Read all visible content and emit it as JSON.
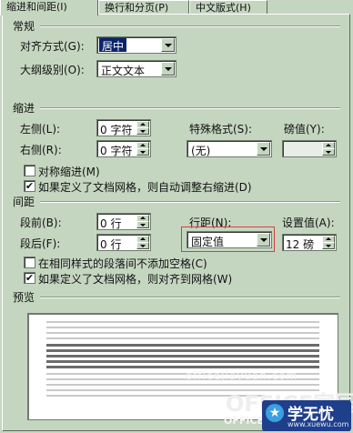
{
  "tabs": [
    {
      "label": "缩进和间距(I)"
    },
    {
      "label": "换行和分页(P)"
    },
    {
      "label": "中文版式(H)"
    }
  ],
  "general": {
    "title": "常规",
    "alignment_label": "对齐方式(G):",
    "alignment_value": "居中",
    "outline_label": "大纲级别(O):",
    "outline_value": "正文文本"
  },
  "indent": {
    "title": "缩进",
    "left_label": "左侧(L):",
    "left_value": "0 字符",
    "right_label": "右侧(R):",
    "right_value": "0 字符",
    "special_label": "特殊格式(S):",
    "special_value": "(无)",
    "by_label": "磅值(Y):",
    "by_value": "",
    "mirror_label": "对称缩进(M)",
    "mirror_checked": false,
    "auto_adjust_label": "如果定义了文档网格，则自动调整右缩进(D)",
    "auto_adjust_checked": true
  },
  "spacing": {
    "title": "间距",
    "before_label": "段前(B):",
    "before_value": "0 行",
    "after_label": "段后(F):",
    "after_value": "0 行",
    "line_spacing_label": "行距(N):",
    "line_spacing_value": "固定值",
    "at_label": "设置值(A):",
    "at_value": "12 磅",
    "no_space_label": "在相同样式的段落间不添加空格(C)",
    "no_space_checked": false,
    "snap_grid_label": "如果定义了文档网格，则对齐到网格(W)",
    "snap_grid_checked": true
  },
  "preview": {
    "title": "预览"
  },
  "watermark": {
    "site": "officejiayuan.com",
    "brand": "OFFICE家园",
    "brand_small": "OFFICE",
    "logo_text": "学无忧",
    "logo_site": "www.xuewu.com"
  },
  "colors": {
    "dialog_bg": "#c5d6c0",
    "selection": "#0a246a",
    "highlight_box": "#d64040"
  }
}
